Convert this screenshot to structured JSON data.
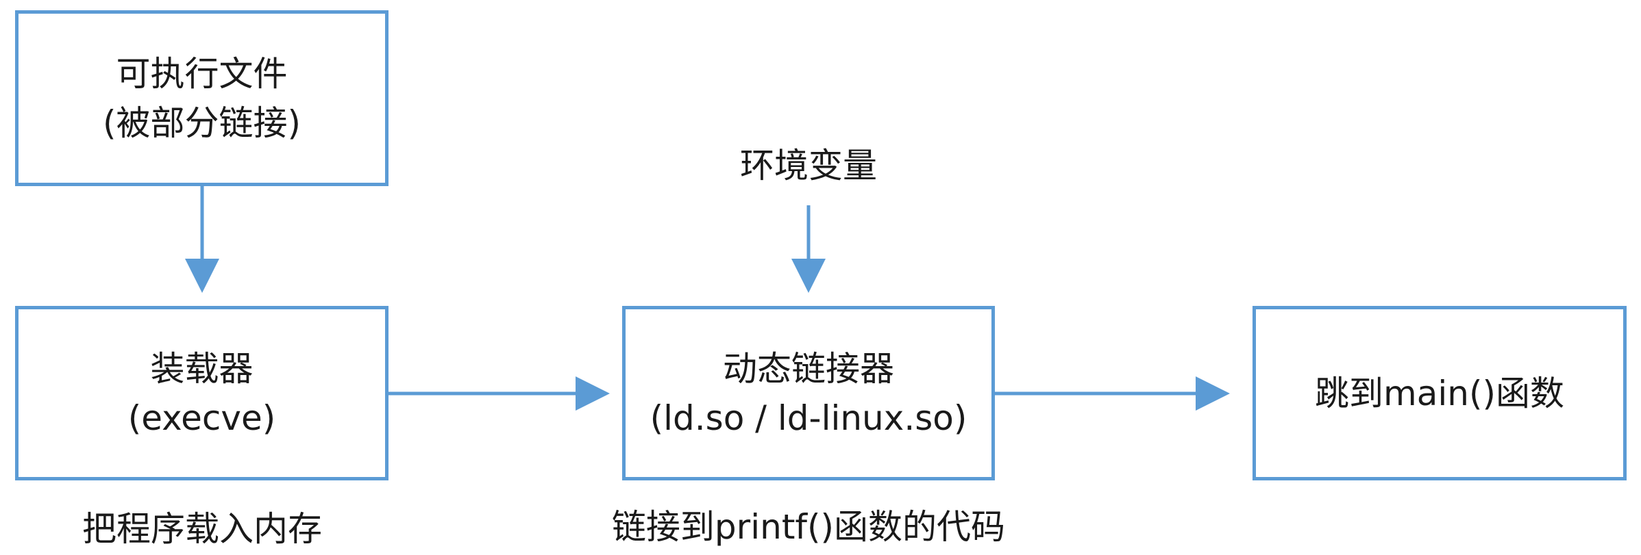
{
  "nodes": {
    "executable": {
      "line1": "可执行文件",
      "line2": "(被部分链接)"
    },
    "loader": {
      "line1": "装载器",
      "line2": "(execve)"
    },
    "dynamic_linker": {
      "line1": "动态链接器",
      "line2": "(ld.so / ld-linux.so)"
    },
    "jump_main": {
      "line1": "跳到main()函数"
    }
  },
  "labels": {
    "env_vars": "环境变量",
    "load_into_memory": "把程序载入内存",
    "link_printf": "链接到printf()函数的代码"
  },
  "colors": {
    "accent": "#5b9bd5"
  }
}
